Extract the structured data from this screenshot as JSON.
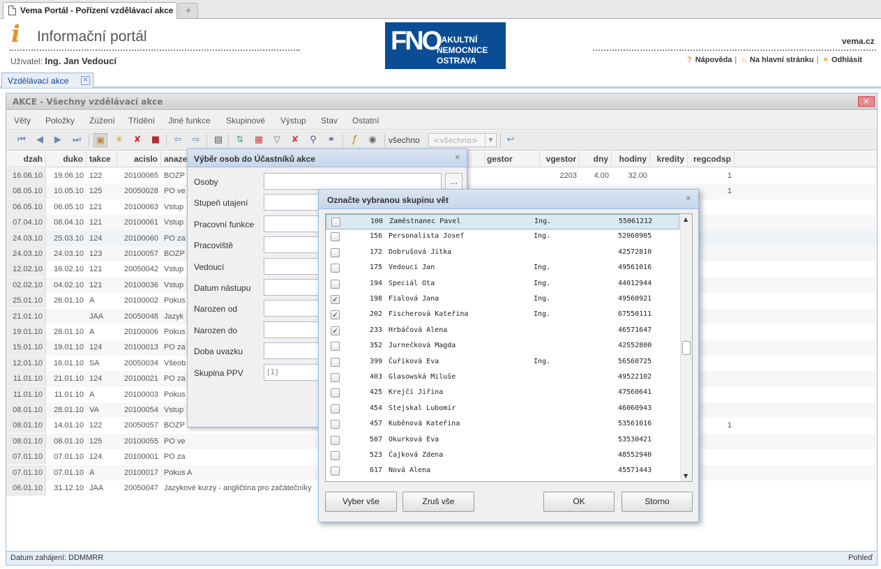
{
  "browser": {
    "tab_title": "Vema Portál - Pořízení vzdělávací akce",
    "new_tab": "+"
  },
  "header": {
    "logo_char": "i",
    "title": "Informační portál",
    "user_label": "Uživatel:",
    "user_name": "Ing. Jan Vedoucí",
    "fno_big": "FNO",
    "fno_line1": "FAKULTNÍ",
    "fno_line2": "NEMOCNICE",
    "fno_line3": "OSTRAVA",
    "site": "vema.cz",
    "help": "Nápověda",
    "home": "Na hlavní stránku",
    "logout": "Odhlásit",
    "sep": "|"
  },
  "app_tab": {
    "label": "Vzdělávací akce",
    "close": "✕"
  },
  "window": {
    "title": "AKCE - Všechny vzdělávací akce",
    "close": "✕"
  },
  "menu": [
    "Věty",
    "Položky",
    "Zúžení",
    "Třídění",
    "Jiné funkce",
    "Skupinové",
    "Výstup",
    "Stav",
    "Ostatní"
  ],
  "toolbar": {
    "all_label": "všechno",
    "combo_value": "<všechno>"
  },
  "grid": {
    "columns": [
      "dzah",
      "duko",
      "takce",
      "acislo",
      "anaze",
      "gestor",
      "vgestor",
      "dny",
      "hodiny",
      "kredity",
      "regcodsp"
    ],
    "rows": [
      [
        "16.06.10",
        "19.06.10",
        "122",
        "20100065",
        "BOZP",
        "",
        "2203",
        "4.00",
        "32.00",
        "",
        "1"
      ],
      [
        "08.05.10",
        "10.05.10",
        "125",
        "20050028",
        "PO ve",
        "",
        "",
        "",
        "",
        "",
        "1"
      ],
      [
        "06.05.10",
        "06.05.10",
        "121",
        "20100063",
        "Vstup",
        "",
        "",
        "",
        "",
        "",
        ""
      ],
      [
        "07.04.10",
        "08.04.10",
        "121",
        "20100061",
        "Vstup",
        "",
        "",
        "",
        "",
        "",
        ""
      ],
      [
        "24.03.10",
        "25.03.10",
        "124",
        "20100060",
        "PO za",
        "",
        "",
        "",
        "",
        "",
        ""
      ],
      [
        "24.03.10",
        "24.03.10",
        "123",
        "20100057",
        "BOZP",
        "",
        "",
        "",
        "",
        "",
        ""
      ],
      [
        "12.02.10",
        "16.02.10",
        "121",
        "20050042",
        "Vstup",
        "",
        "",
        "",
        "",
        "",
        ""
      ],
      [
        "02.02.10",
        "04.02.10",
        "121",
        "20100036",
        "Vstup",
        "",
        "",
        "",
        "",
        "",
        ""
      ],
      [
        "25.01.10",
        "26.01.10",
        "A",
        "20100002",
        "Pokus",
        "",
        "",
        "",
        "",
        "",
        ""
      ],
      [
        "21.01.10",
        "",
        "JAA",
        "20050048",
        "Jazyk",
        "",
        "",
        "",
        "",
        "",
        ""
      ],
      [
        "19.01.10",
        "28.01.10",
        "A",
        "20100006",
        "Pokus",
        "",
        "",
        "",
        "",
        "",
        ""
      ],
      [
        "15.01.10",
        "19.01.10",
        "124",
        "20100013",
        "PO za",
        "",
        "",
        "",
        "",
        "",
        ""
      ],
      [
        "12.01.10",
        "16.01.10",
        "SA",
        "20050034",
        "Všeob",
        "",
        "",
        "",
        "",
        "",
        ""
      ],
      [
        "11.01.10",
        "21.01.10",
        "124",
        "20100021",
        "PO za",
        "",
        "",
        "",
        "",
        "",
        ""
      ],
      [
        "11.01.10",
        "11.01.10",
        "A",
        "20100003",
        "Pokus",
        "",
        "",
        "",
        "",
        "",
        ""
      ],
      [
        "08.01.10",
        "28.01.10",
        "VA",
        "20100054",
        "Vstup",
        "",
        "",
        "",
        "",
        "",
        ""
      ],
      [
        "08.01.10",
        "14.01.10",
        "122",
        "20050057",
        "BOZP",
        "",
        "",
        "",
        "",
        "",
        "1"
      ],
      [
        "08.01.10",
        "08.01.10",
        "125",
        "20100055",
        "PO ve",
        "",
        "",
        "",
        "",
        "",
        ""
      ],
      [
        "07.01.10",
        "07.01.10",
        "124",
        "20100001",
        "PO za",
        "",
        "",
        "",
        "",
        "",
        ""
      ],
      [
        "07.01.10",
        "07.01.10",
        "A",
        "20100017",
        "Pokus A",
        "",
        "",
        "",
        "",
        "",
        ""
      ],
      [
        "06.01.10",
        "31.12.10",
        "JAA",
        "20050047",
        "Jazykové kurzy - angličtina pro začátečníky",
        "",
        "",
        "",
        "",
        "",
        ""
      ]
    ]
  },
  "status": {
    "left": "Datum zahájení: DDMMRR",
    "right": "Pohleď"
  },
  "dialog1": {
    "title": "Výběr osob do Účastníků akce",
    "close": "✕",
    "browse": "...",
    "fields": [
      {
        "label": "Osoby",
        "value": ""
      },
      {
        "label": "Stupeň utajení",
        "value": ""
      },
      {
        "label": "Pracovní funkce",
        "value": ""
      },
      {
        "label": "Pracoviště",
        "value": ""
      },
      {
        "label": "Vedoucí",
        "value": ""
      },
      {
        "label": "Datum nástupu",
        "value": ""
      },
      {
        "label": "Narozen od",
        "value": ""
      },
      {
        "label": "Narozen do",
        "value": ""
      },
      {
        "label": "Doba uvazku",
        "value": ""
      },
      {
        "label": "Skupina PPV",
        "value": "[1]"
      }
    ]
  },
  "dialog2": {
    "title": "Označte vybranou skupinu vět",
    "close": "✕",
    "rows": [
      {
        "checked": false,
        "id": "100",
        "name": "Zaměstnanec Pavel",
        "title": "Ing.",
        "num": "55061212"
      },
      {
        "checked": false,
        "id": "156",
        "name": "Personalista Josef",
        "title": "Ing.",
        "num": "52060905"
      },
      {
        "checked": false,
        "id": "172",
        "name": "Dobrušová Jitka",
        "title": "",
        "num": "42572810"
      },
      {
        "checked": false,
        "id": "175",
        "name": "Vedoucí Jan",
        "title": "Ing.",
        "num": "49561016"
      },
      {
        "checked": false,
        "id": "194",
        "name": "Speciál Ota",
        "title": "Ing.",
        "num": "44012944"
      },
      {
        "checked": true,
        "id": "198",
        "name": "Fialová Jana",
        "title": "Ing.",
        "num": "49560921"
      },
      {
        "checked": true,
        "id": "202",
        "name": "Fischerová Kateřina",
        "title": "Ing.",
        "num": "67550111"
      },
      {
        "checked": true,
        "id": "233",
        "name": "Hrbáčová Alena",
        "title": "",
        "num": "46571647"
      },
      {
        "checked": false,
        "id": "352",
        "name": "Jurnečková Magda",
        "title": "",
        "num": "42552800"
      },
      {
        "checked": false,
        "id": "399",
        "name": "Čuříková Eva",
        "title": "Ing.",
        "num": "56560725"
      },
      {
        "checked": false,
        "id": "403",
        "name": "Glasowská Miluše",
        "title": "",
        "num": "49522102"
      },
      {
        "checked": false,
        "id": "425",
        "name": "Krejčí Jiřina",
        "title": "",
        "num": "47560641"
      },
      {
        "checked": false,
        "id": "454",
        "name": "Stejskal Lubomír",
        "title": "",
        "num": "46060943"
      },
      {
        "checked": false,
        "id": "457",
        "name": "Kuběnová Kateřina",
        "title": "",
        "num": "53561016"
      },
      {
        "checked": false,
        "id": "507",
        "name": "Okurková Eva",
        "title": "",
        "num": "53530421"
      },
      {
        "checked": false,
        "id": "523",
        "name": "Čajková Zdena",
        "title": "",
        "num": "48552940"
      },
      {
        "checked": false,
        "id": "617",
        "name": "Nová Alena",
        "title": "",
        "num": "45571443"
      }
    ],
    "buttons": {
      "select_all": "Vyber vše",
      "clear_all": "Zruš vše",
      "ok": "OK",
      "cancel": "Storno"
    },
    "checkmark": "✓"
  }
}
